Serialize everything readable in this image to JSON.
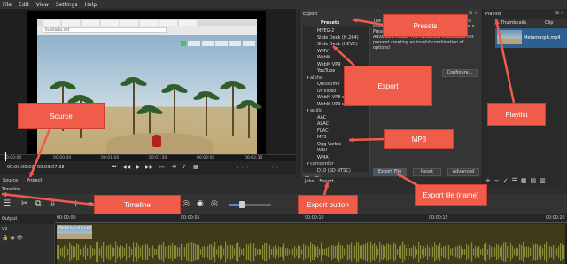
{
  "menu": [
    "File",
    "Edit",
    "View",
    "Settings",
    "Help"
  ],
  "source": {
    "browser_url": "livestorka.net",
    "timecode_current": "00:00:00:02",
    "timecode_separator": "/",
    "timecode_total": "00:03:07:38",
    "timecode_in": "--:--:--:--",
    "timecode_out": "--:--:--:--",
    "ruler_ticks": [
      "00:00:00",
      "00:00:30",
      "00:01:00",
      "00:01:30",
      "00:02:00",
      "00:02:30"
    ],
    "tabs": [
      "Source",
      "Project"
    ]
  },
  "export": {
    "title": "Export",
    "window_controls": "⊠ ✕",
    "presets_header": "Presets",
    "presets": [
      {
        "label": "MPEG-2",
        "group": false
      },
      {
        "label": "Slide Deck (H.264)",
        "group": false
      },
      {
        "label": "Slide Deck (HEVC)",
        "group": false
      },
      {
        "label": "WMV",
        "group": false
      },
      {
        "label": "WebM",
        "group": false
      },
      {
        "label": "WebM VP9",
        "group": false
      },
      {
        "label": "YouTube",
        "group": false
      },
      {
        "label": "▾ alpha",
        "group": true
      },
      {
        "label": "Quicktime",
        "group": false
      },
      {
        "label": "Ut Video",
        "group": false
      },
      {
        "label": "WebM VP8 with...",
        "group": false
      },
      {
        "label": "WebM VP9 with...",
        "group": false
      },
      {
        "label": "▾ audio",
        "group": true
      },
      {
        "label": "AAC",
        "group": false
      },
      {
        "label": "ALAC",
        "group": false
      },
      {
        "label": "FLAC",
        "group": false
      },
      {
        "label": "MP3",
        "group": false
      },
      {
        "label": "Ogg Vorbis",
        "group": false
      },
      {
        "label": "WAV",
        "group": false
      },
      {
        "label": "WMA",
        "group": false
      },
      {
        "label": "▾ camcorder",
        "group": true
      },
      {
        "label": "D10 (SD NTSC)",
        "group": false
      }
    ],
    "description": "The default preset is H.264/AAC MP4 (which is suitable for most users and purposes. Choose a Preset at the left before deciding to use the Advanced mode. The Advanced mode does not prevent creating an invalid combination of options!",
    "configure_label": "Configure...",
    "export_file_label": "Export File",
    "reset_label": "Reset",
    "advanced_label": "Advanced",
    "add_label": "+",
    "remove_label": "−"
  },
  "jobs_tabs": [
    "Jobs",
    "Export"
  ],
  "playlist": {
    "title": "Playlist",
    "window_controls": "⊠ ✕",
    "col_thumbnails": "Thumbnails",
    "col_clip": "Clip",
    "clip_name": "Metamorph.mp4",
    "toolbar": [
      "+",
      "−",
      "✓",
      "☰",
      "▦",
      "▤",
      "▥"
    ]
  },
  "timeline": {
    "title": "Timeline",
    "output_label": "Output",
    "ruler_ticks": [
      "00:00:00",
      "00:00:05",
      "00:00:10",
      "00:00:15",
      "00:00:20"
    ],
    "track_name": "V1",
    "clip_label": "Metamorph.mp4",
    "toolbar_icons": [
      "☰",
      "✂",
      "⧉",
      "⇩",
      "+",
      "−",
      "⊏",
      "⊐",
      "⊓",
      "⇥",
      "◎",
      "◉",
      "◎"
    ]
  },
  "callouts": {
    "source": "Source",
    "timeline": "Timeline",
    "presets": "Presets",
    "export": "Export",
    "mp3": "MP3",
    "export_button": "Export button",
    "export_file": "Export file (name)",
    "playlist": "Playlist"
  },
  "colors": {
    "callout_fill": "#f05c4a",
    "callout_stroke": "#c8402f",
    "selection": "#2f5f8f",
    "audio_clip": "#3e3a1a",
    "waveform": "#8a8a3a"
  }
}
